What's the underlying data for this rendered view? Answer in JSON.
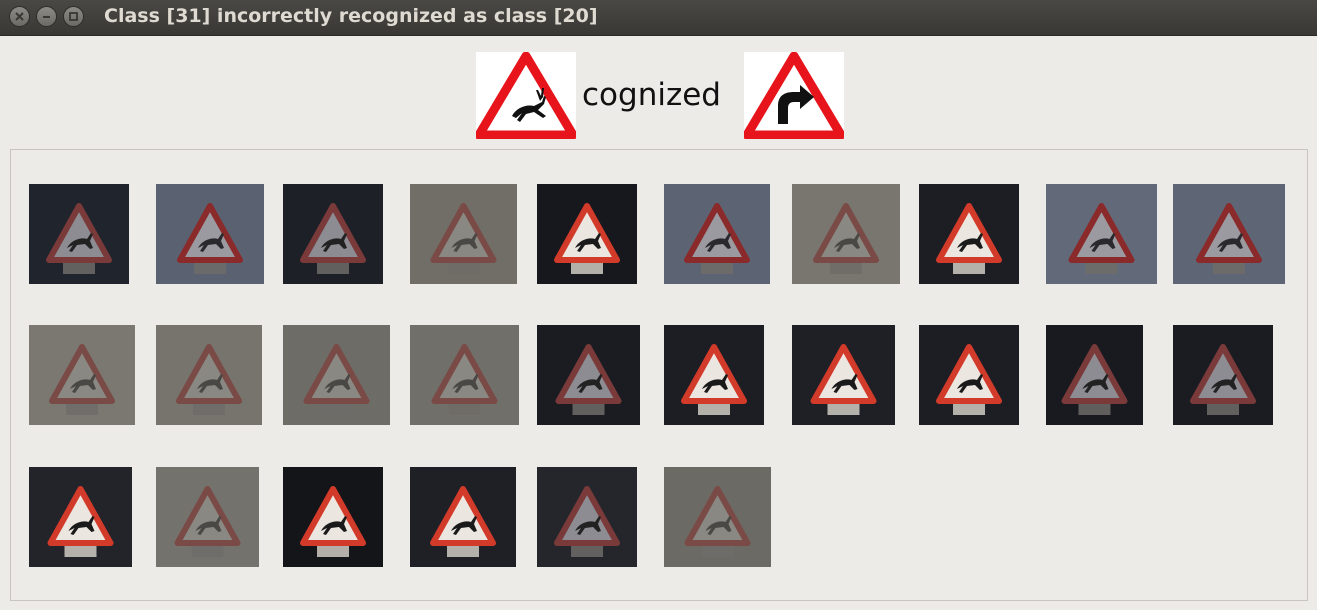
{
  "window": {
    "title": "Class [31] incorrectly recognized as class [20]",
    "buttons": [
      "close",
      "minimize",
      "maximize"
    ]
  },
  "header": {
    "text": "cognized",
    "left_sign_icon": "wild-animals-warning-sign-icon",
    "right_sign_icon": "dangerous-curve-right-sign-icon"
  },
  "thumbnails": [
    {
      "bg": "#20242c",
      "sign": "dark"
    },
    {
      "bg": "#5a6272",
      "sign": "normal"
    },
    {
      "bg": "#1e2028",
      "sign": "dark"
    },
    {
      "bg": "#706e66",
      "sign": "faded"
    },
    {
      "bg": "#16181e",
      "sign": "bright"
    },
    {
      "bg": "#5c6474",
      "sign": "normal"
    },
    {
      "bg": "#78766e",
      "sign": "faded"
    },
    {
      "bg": "#1c1e24",
      "sign": "bright"
    },
    {
      "bg": "#626a7a",
      "sign": "normal"
    },
    {
      "bg": "#5e6676",
      "sign": "normal"
    },
    {
      "bg": "#7a7870",
      "sign": "faded"
    },
    {
      "bg": "#76746c",
      "sign": "faded"
    },
    {
      "bg": "#6e6c66",
      "sign": "faded"
    },
    {
      "bg": "#716f69",
      "sign": "faded"
    },
    {
      "bg": "#1a1c22",
      "sign": "dark"
    },
    {
      "bg": "#1c1e24",
      "sign": "bright"
    },
    {
      "bg": "#1e2026",
      "sign": "bright"
    },
    {
      "bg": "#1c1e24",
      "sign": "bright"
    },
    {
      "bg": "#181a20",
      "sign": "dark"
    },
    {
      "bg": "#1a1c22",
      "sign": "dark"
    },
    {
      "bg": "#22242a",
      "sign": "bright"
    },
    {
      "bg": "#74726c",
      "sign": "faded"
    },
    {
      "bg": "#141519",
      "sign": "bright"
    },
    {
      "bg": "#1e2026",
      "sign": "bright"
    },
    {
      "bg": "#24262c",
      "sign": "dark"
    },
    {
      "bg": "#6c6a64",
      "sign": "faded"
    }
  ],
  "colors": {
    "sign_red": "#e8141c",
    "titlebar": "#3c3b37",
    "window_bg": "#edebe7"
  }
}
